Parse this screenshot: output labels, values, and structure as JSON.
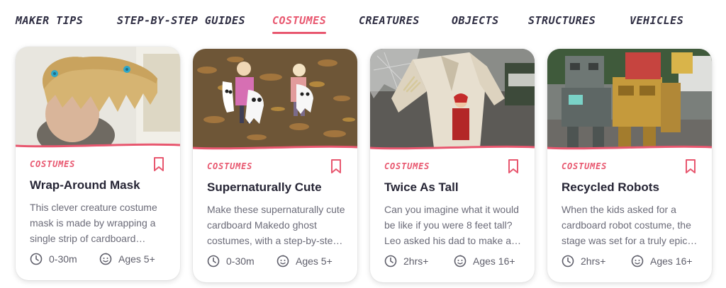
{
  "nav": {
    "items": [
      {
        "label": "MAKER TIPS"
      },
      {
        "label": "STEP-BY-STEP GUIDES"
      },
      {
        "label": "COSTUMES",
        "active": true
      },
      {
        "label": "CREATURES"
      },
      {
        "label": "OBJECTS"
      },
      {
        "label": "STRUCTURES"
      },
      {
        "label": "VEHICLES"
      }
    ]
  },
  "colors": {
    "accent": "#e8576f",
    "text": "#262535",
    "muted": "#6b6b78",
    "icon": "#5e5e6a"
  },
  "cards": [
    {
      "category": "COSTUMES",
      "title": "Wrap-Around Mask",
      "description": "This clever creature costume mask is made by wrapping a single strip of cardboard around your head.",
      "time": "0-30m",
      "ages": "Ages 5+",
      "bookmark_icon": "bookmark-icon"
    },
    {
      "category": "COSTUMES",
      "title": "Supernaturally Cute",
      "description": "Make these supernaturally cute cardboard Makedo ghost costumes, with a step-by-step guide.",
      "time": "0-30m",
      "ages": "Ages 5+",
      "bookmark_icon": "bookmark-icon"
    },
    {
      "category": "COSTUMES",
      "title": "Twice As Tall",
      "description": "Can you imagine what it would be like if you were 8 feet tall? Leo asked his dad to make a costume.",
      "time": "2hrs+",
      "ages": "Ages 16+",
      "bookmark_icon": "bookmark-icon"
    },
    {
      "category": "COSTUMES",
      "title": "Recycled Robots",
      "description": "When the kids asked for a cardboard robot costume, the stage was set for a truly epic build.",
      "time": "2hrs+",
      "ages": "Ages 16+",
      "bookmark_icon": "bookmark-icon"
    }
  ]
}
